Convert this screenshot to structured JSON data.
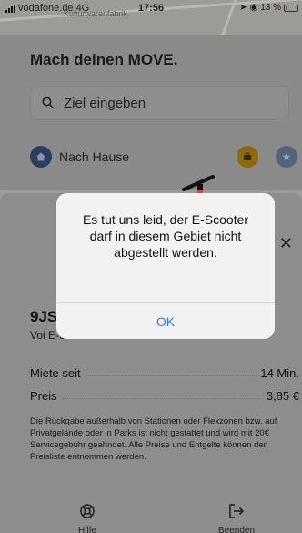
{
  "status_bar": {
    "carrier": "vodafone.de",
    "network": "4G",
    "time": "17:56",
    "battery": "13 %"
  },
  "map": {
    "label": "Kulturwarenfabrik"
  },
  "search": {
    "headline": "Mach deinen MOVE.",
    "placeholder": "Ziel eingeben",
    "home_label": "Nach Hause"
  },
  "sheet": {
    "vehicle_id": "9JS",
    "vehicle_type": "Voi E-Scooter",
    "rows": [
      {
        "label": "Miete seit",
        "value": "14 Min."
      },
      {
        "label": "Preis",
        "value": "3,85 €"
      }
    ],
    "notice": "Die Rückgabe außerhalb von Stationen oder Flexzonen bzw. auf Privatgelände oder in Parks ist nicht gestattet und wird mit 20€ Servicegebühr geahndet. Alle Preise und Entgelte können der Preisliste entnommen werden.",
    "help_label": "Hilfe",
    "end_label": "Beenden"
  },
  "alert": {
    "message": "Es tut uns leid, der E-Scooter darf in diesem Gebiet nicht abgestellt werden.",
    "ok_label": "OK"
  },
  "colors": {
    "accent": "#2c7cf6",
    "scooter_red": "#e0443a"
  }
}
